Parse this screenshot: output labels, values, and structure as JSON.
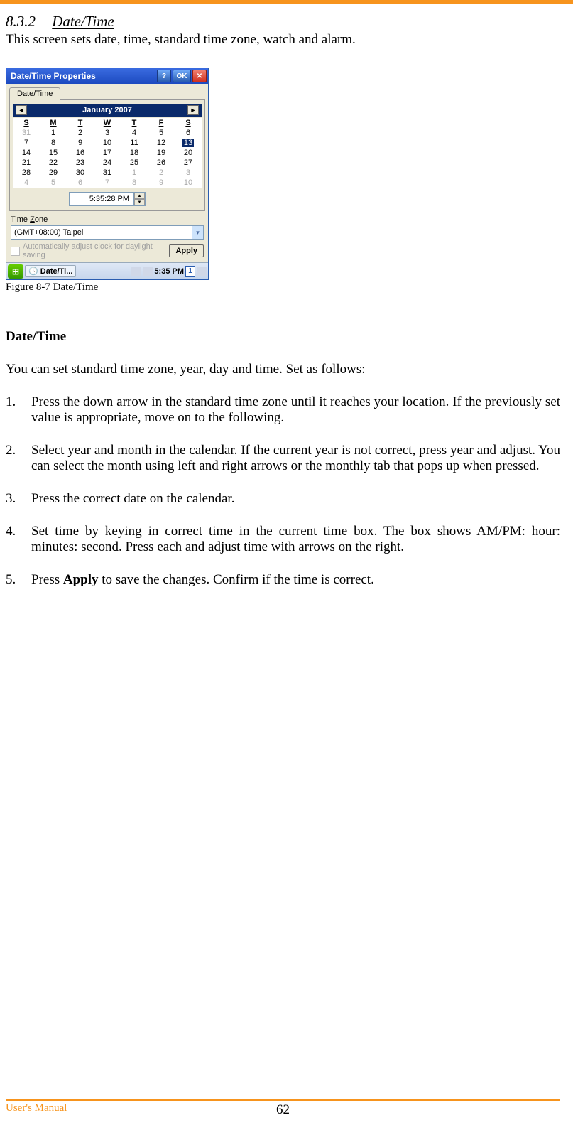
{
  "header": {
    "section_number": "8.3.2",
    "section_title": "Date/Time",
    "intro": "This screen sets date, time, standard time zone, watch and alarm."
  },
  "screenshot": {
    "title": "Date/Time Properties",
    "help": "?",
    "ok": "OK",
    "close": "✕",
    "tab": "Date/Time",
    "month_header": "January 2007",
    "day_headers": [
      "S",
      "M",
      "T",
      "W",
      "T",
      "F",
      "S"
    ],
    "rows": [
      [
        {
          "v": "31",
          "g": true
        },
        {
          "v": "1"
        },
        {
          "v": "2"
        },
        {
          "v": "3"
        },
        {
          "v": "4"
        },
        {
          "v": "5"
        },
        {
          "v": "6"
        }
      ],
      [
        {
          "v": "7"
        },
        {
          "v": "8"
        },
        {
          "v": "9"
        },
        {
          "v": "10"
        },
        {
          "v": "11"
        },
        {
          "v": "12"
        },
        {
          "v": "13",
          "sel": true
        }
      ],
      [
        {
          "v": "14"
        },
        {
          "v": "15"
        },
        {
          "v": "16"
        },
        {
          "v": "17"
        },
        {
          "v": "18"
        },
        {
          "v": "19"
        },
        {
          "v": "20"
        }
      ],
      [
        {
          "v": "21"
        },
        {
          "v": "22"
        },
        {
          "v": "23"
        },
        {
          "v": "24"
        },
        {
          "v": "25"
        },
        {
          "v": "26"
        },
        {
          "v": "27"
        }
      ],
      [
        {
          "v": "28"
        },
        {
          "v": "29"
        },
        {
          "v": "30"
        },
        {
          "v": "31"
        },
        {
          "v": "1",
          "g": true
        },
        {
          "v": "2",
          "g": true
        },
        {
          "v": "3",
          "g": true
        }
      ],
      [
        {
          "v": "4",
          "g": true
        },
        {
          "v": "5",
          "g": true
        },
        {
          "v": "6",
          "g": true
        },
        {
          "v": "7",
          "g": true
        },
        {
          "v": "8",
          "g": true
        },
        {
          "v": "9",
          "g": true
        },
        {
          "v": "10",
          "g": true
        }
      ]
    ],
    "time_value": "5:35:28 PM",
    "tz_label_pre": "Time ",
    "tz_label_u": "Z",
    "tz_label_post": "one",
    "tz_value": "(GMT+08:00) Taipei",
    "auto_text": "Automatically adjust clock for daylight saving",
    "apply": "Apply",
    "taskbar_item": "Date/Ti...",
    "taskbar_clock": "5:35 PM",
    "taskbar_ind": "1"
  },
  "figure_caption": "Figure 8-7 Date/Time",
  "body": {
    "subheading": "Date/Time",
    "lead": "You can set standard time zone, year, day and time. Set as follows:",
    "steps": [
      "Press the down arrow in the standard time zone until it reaches your location. If the previously set value is appropriate, move on to the following.",
      "Select year and month in the calendar. If the current year is not correct, press year and adjust. You can select the month using left and right arrows or the monthly tab that pops up when pressed.",
      "Press the correct date on the calendar.",
      "Set time by keying in correct time in the current time box. The box shows AM/PM: hour: minutes: second. Press each and adjust time with arrows on the right.",
      "Press <b>Apply</b> to save the changes. Confirm if the time is correct."
    ]
  },
  "footer": {
    "manual": "User's Manual",
    "page": "62"
  }
}
